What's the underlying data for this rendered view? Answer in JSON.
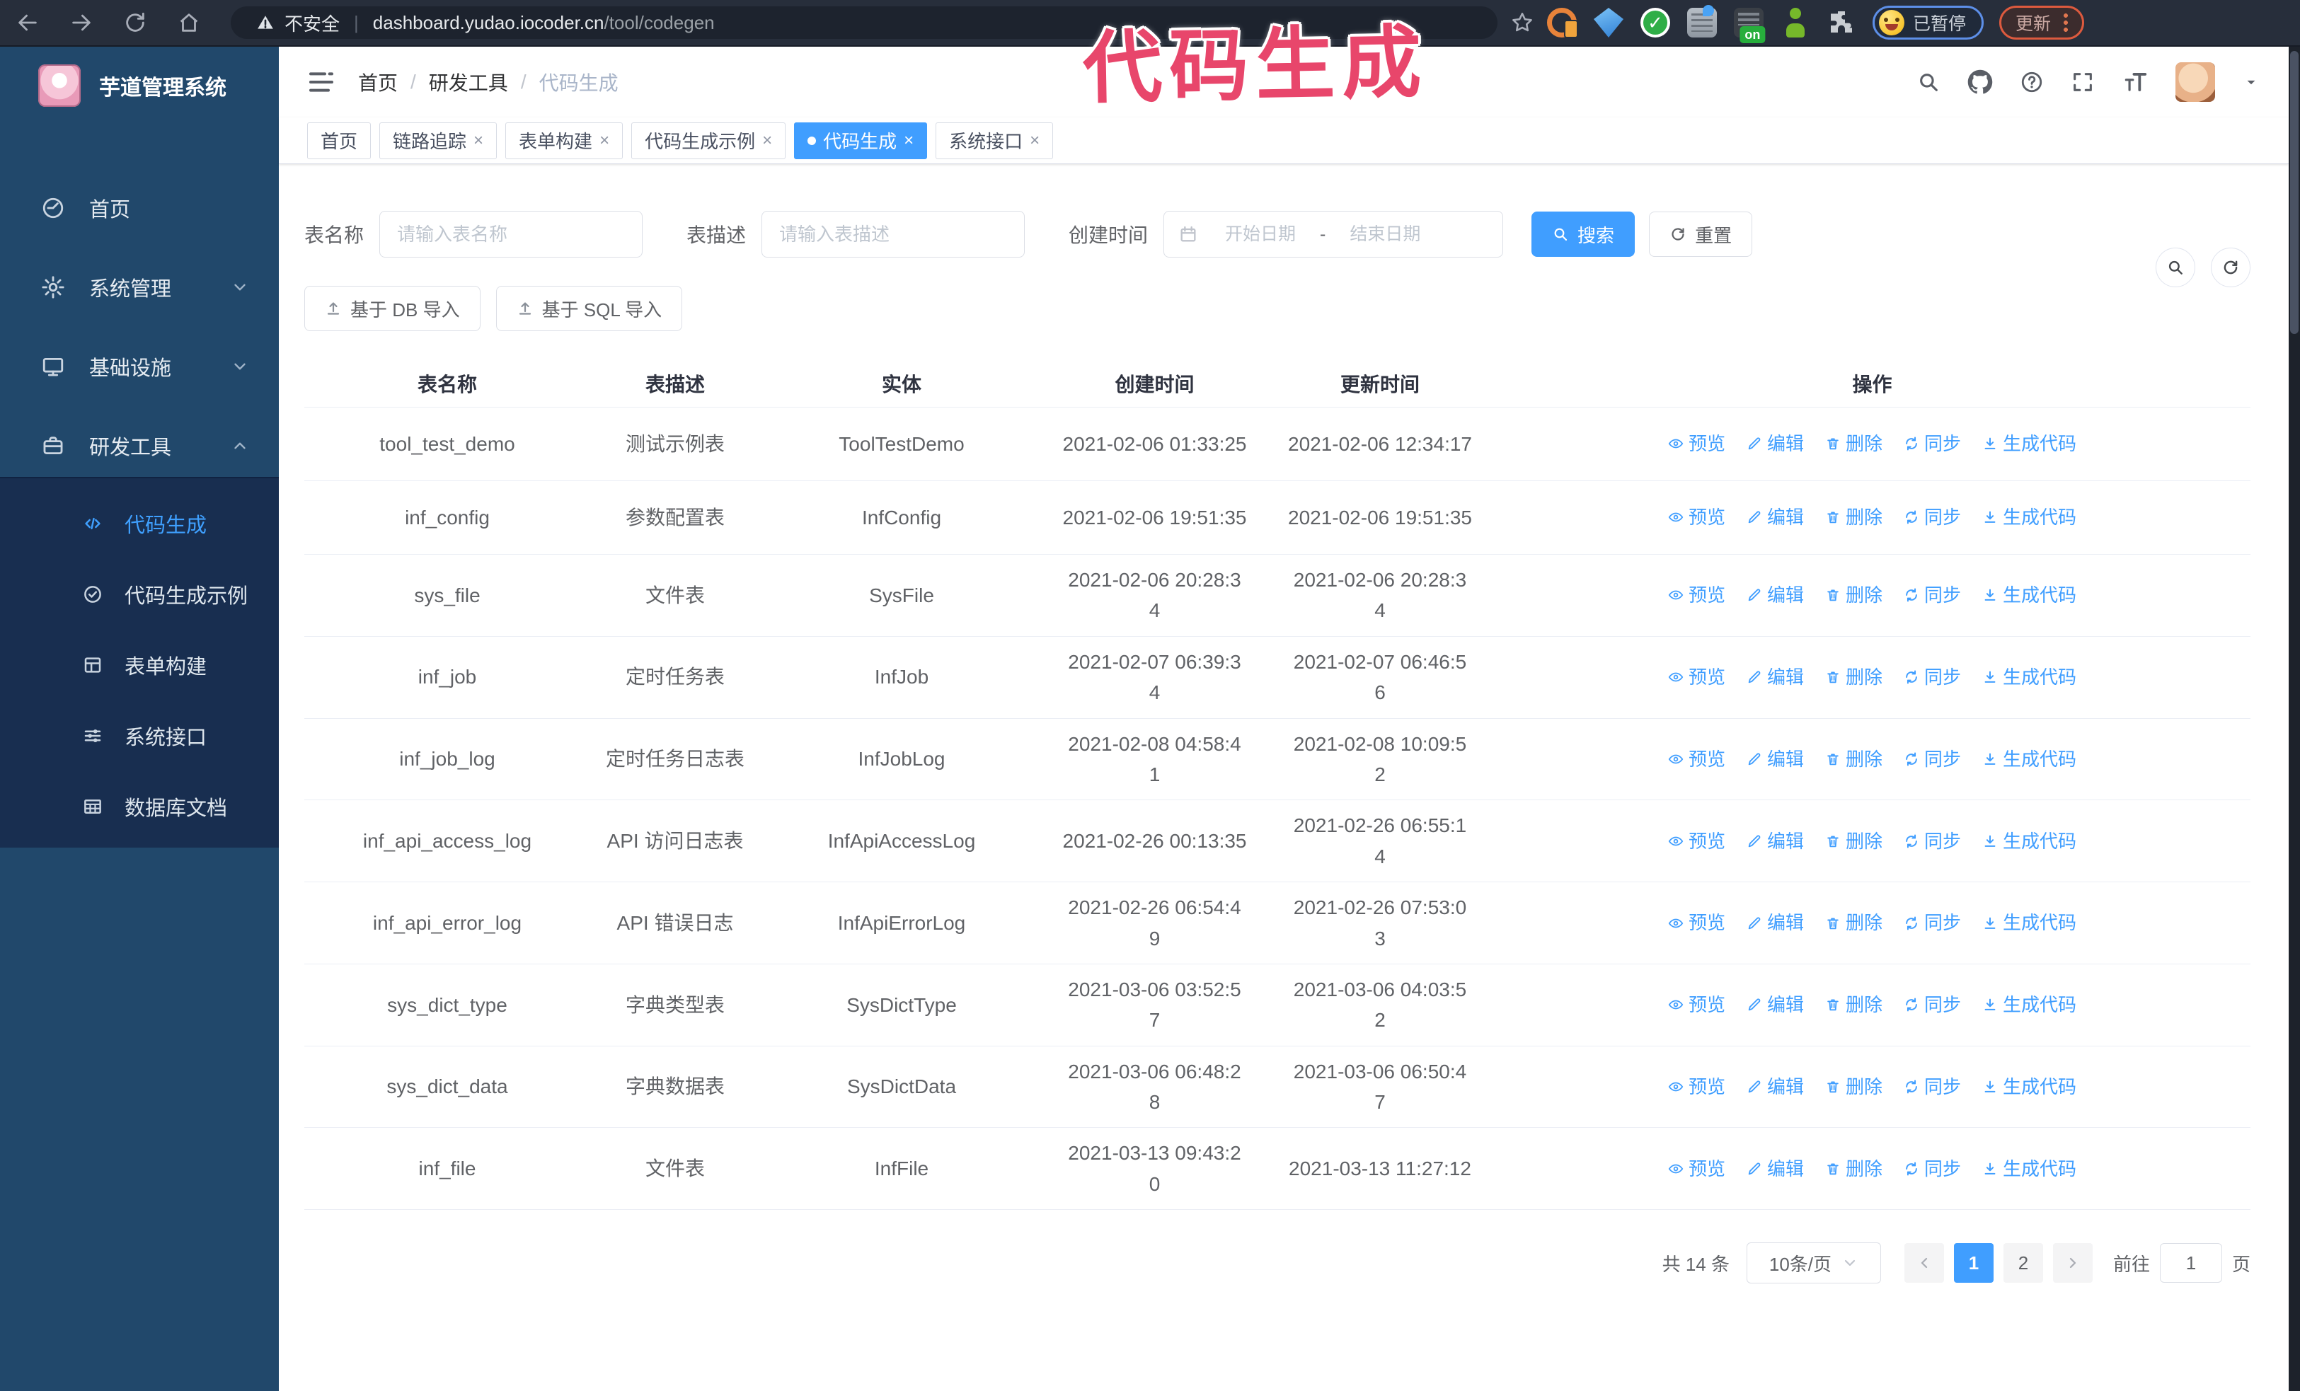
{
  "colors": {
    "accent": "#409eff",
    "sidebar_bg": "#21486b",
    "submenu_bg": "#182e50",
    "annotation_pink": "#e8466b",
    "link_blue": "#409eff",
    "tab_active": "#409eff"
  },
  "annotation": "代码生成",
  "browser": {
    "security_label": "不安全",
    "url_divider": "|",
    "url_domain": "dashboard.yudao.iocoder.cn",
    "url_path": "/tool/codegen",
    "paused_badge": "已暂停",
    "update_button": "更新",
    "ext_on_badge": "on",
    "extension_icons": [
      "orange-doc-icon",
      "blue-gem-icon",
      "green-check-icon",
      "grid-drop-icon",
      "dark-on-icon",
      "green-person-icon",
      "puzzle-icon"
    ]
  },
  "sidebar": {
    "title": "芋道管理系统",
    "items": [
      {
        "label": "首页",
        "icon": "dashboard-icon",
        "chevron": null
      },
      {
        "label": "系统管理",
        "icon": "gear-icon",
        "chevron": "down"
      },
      {
        "label": "基础设施",
        "icon": "infra-icon",
        "chevron": "down"
      },
      {
        "label": "研发工具",
        "icon": "briefcase-icon",
        "chevron": "up",
        "expanded": true
      }
    ],
    "sub_items": [
      {
        "label": "代码生成",
        "icon": "code-icon",
        "active": true
      },
      {
        "label": "代码生成示例",
        "icon": "example-icon",
        "active": false
      },
      {
        "label": "表单构建",
        "icon": "form-icon",
        "active": false
      },
      {
        "label": "系统接口",
        "icon": "api-icon",
        "active": false
      },
      {
        "label": "数据库文档",
        "icon": "dbdoc-icon",
        "active": false
      }
    ]
  },
  "navbar": {
    "breadcrumb": [
      "首页",
      "研发工具",
      "代码生成"
    ],
    "separator": "/"
  },
  "tabs": [
    {
      "label": "首页",
      "closable": false,
      "active": false
    },
    {
      "label": "链路追踪",
      "closable": true,
      "active": false
    },
    {
      "label": "表单构建",
      "closable": true,
      "active": false
    },
    {
      "label": "代码生成示例",
      "closable": true,
      "active": false
    },
    {
      "label": "代码生成",
      "closable": true,
      "active": true
    },
    {
      "label": "系统接口",
      "closable": true,
      "active": false
    }
  ],
  "filters": {
    "name_label": "表名称",
    "name_ph": "请输入表名称",
    "desc_label": "表描述",
    "desc_ph": "请输入表描述",
    "time_label": "创建时间",
    "start_ph": "开始日期",
    "range_sep": "-",
    "end_ph": "结束日期",
    "search": "搜索",
    "reset": "重置"
  },
  "toolbar": {
    "db_import": "基于 DB 导入",
    "sql_import": "基于 SQL 导入"
  },
  "table": {
    "headers": [
      "表名称",
      "表描述",
      "实体",
      "创建时间",
      "更新时间",
      "操作"
    ],
    "row_actions": [
      {
        "label": "预览",
        "icon": "eye-icon",
        "action": "preview"
      },
      {
        "label": "编辑",
        "icon": "edit-icon",
        "action": "edit"
      },
      {
        "label": "删除",
        "icon": "trash-icon",
        "action": "delete"
      },
      {
        "label": "同步",
        "icon": "sync-icon",
        "action": "sync"
      },
      {
        "label": "生成代码",
        "icon": "download-icon",
        "action": "generate"
      }
    ],
    "rows": [
      {
        "name": "tool_test_demo",
        "desc": "测试示例表",
        "entity": "ToolTestDemo",
        "created": "2021-02-06 01:33:25",
        "updated": "2021-02-06 12:34:17"
      },
      {
        "name": "inf_config",
        "desc": "参数配置表",
        "entity": "InfConfig",
        "created": "2021-02-06 19:51:35",
        "updated": "2021-02-06 19:51:35"
      },
      {
        "name": "sys_file",
        "desc": "文件表",
        "entity": "SysFile",
        "created": "2021-02-06 20:28:3\n4",
        "updated": "2021-02-06 20:28:3\n4"
      },
      {
        "name": "inf_job",
        "desc": "定时任务表",
        "entity": "InfJob",
        "created": "2021-02-07 06:39:3\n4",
        "updated": "2021-02-07 06:46:5\n6"
      },
      {
        "name": "inf_job_log",
        "desc": "定时任务日志表",
        "entity": "InfJobLog",
        "created": "2021-02-08 04:58:4\n1",
        "updated": "2021-02-08 10:09:5\n2"
      },
      {
        "name": "inf_api_access_log",
        "desc": "API 访问日志表",
        "entity": "InfApiAccessLog",
        "created": "2021-02-26 00:13:35",
        "updated": "2021-02-26 06:55:1\n4"
      },
      {
        "name": "inf_api_error_log",
        "desc": "API 错误日志",
        "entity": "InfApiErrorLog",
        "created": "2021-02-26 06:54:4\n9",
        "updated": "2021-02-26 07:53:0\n3"
      },
      {
        "name": "sys_dict_type",
        "desc": "字典类型表",
        "entity": "SysDictType",
        "created": "2021-03-06 03:52:5\n7",
        "updated": "2021-03-06 04:03:5\n2"
      },
      {
        "name": "sys_dict_data",
        "desc": "字典数据表",
        "entity": "SysDictData",
        "created": "2021-03-06 06:48:2\n8",
        "updated": "2021-03-06 06:50:4\n7"
      },
      {
        "name": "inf_file",
        "desc": "文件表",
        "entity": "InfFile",
        "created": "2021-03-13 09:43:2\n0",
        "updated": "2021-03-13 11:27:12"
      }
    ]
  },
  "pagination": {
    "total": "共 14 条",
    "page_size": "10条/页",
    "pages": [
      "1",
      "2"
    ],
    "current": "1",
    "goto_label": "前往",
    "goto_value": "1",
    "page_suffix": "页"
  }
}
